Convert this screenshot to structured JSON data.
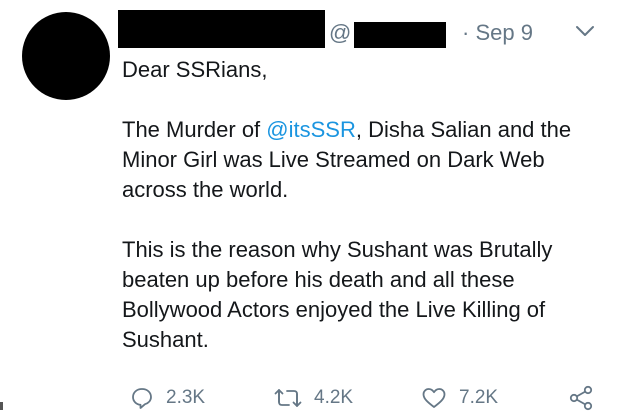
{
  "tweet": {
    "handle_prefix": "@",
    "date": "· Sep 9",
    "paragraphs": [
      [
        "Dear SSRians,"
      ],
      [
        "The Murder of ",
        "@itsSSR",
        ", Disha Salian and the Minor Girl was Live Streamed on Dark Web across the world."
      ],
      [
        "This is the reason why Sushant was Brutally beaten up before his death and all these Bollywood Actors enjoyed the Live Killing of Sushant."
      ]
    ],
    "p2": {
      "before": "The Murder of ",
      "mention": "@itsSSR",
      "after": ", Disha Salian and the Minor Girl was Live Streamed on Dark Web across the world."
    },
    "p1": "Dear SSRians,",
    "p3": "This is the reason why Sushant was Brutally beaten up before his death and all these Bollywood Actors enjoyed the Live Killing of Sushant."
  },
  "actions": {
    "reply": {
      "icon": "reply-icon",
      "count": "2.3K"
    },
    "retweet": {
      "icon": "retweet-icon",
      "count": "4.2K"
    },
    "like": {
      "icon": "heart-icon",
      "count": "7.2K"
    },
    "share": {
      "icon": "share-icon"
    }
  },
  "colors": {
    "text": "#14171a",
    "muted": "#657786",
    "link": "#1b95e0",
    "redaction": "#000000"
  }
}
